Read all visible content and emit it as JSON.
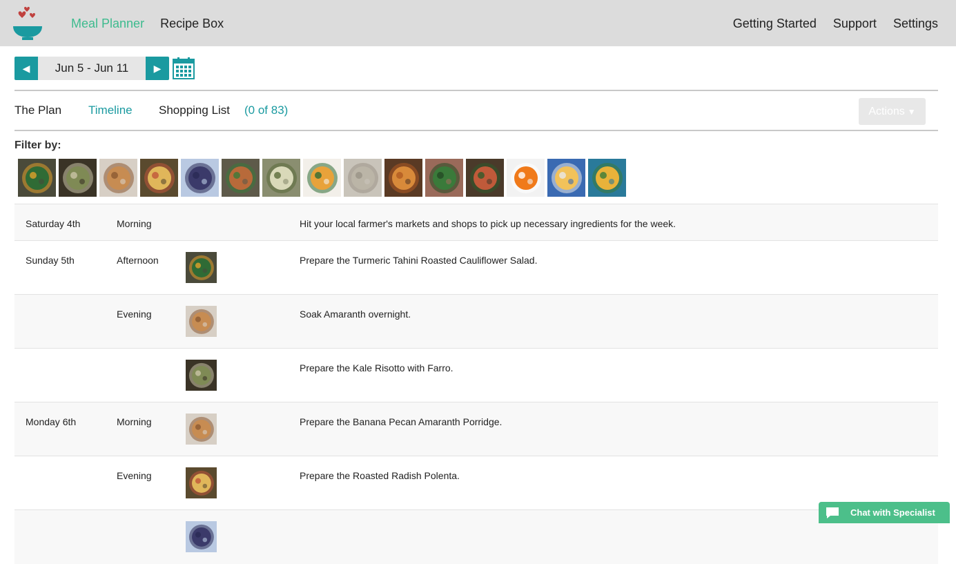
{
  "header": {
    "nav_left": [
      "Meal Planner",
      "Recipe Box"
    ],
    "nav_right": [
      "Getting Started",
      "Support",
      "Settings"
    ],
    "brand_color": "#3dbb8e"
  },
  "week": {
    "label": "Jun 5 - Jun 11",
    "accent": "#1a9aa0"
  },
  "tabs": {
    "plan": "The Plan",
    "timeline": "Timeline",
    "shopping": "Shopping List",
    "shopping_count": "(0 of 83)"
  },
  "actions_label": "Actions",
  "filter": {
    "label": "Filter by:",
    "thumbs": [
      {
        "bg": "#4a4a3a",
        "fg": "#2f6b35",
        "accent": "#e0a12a"
      },
      {
        "bg": "#3a3326",
        "fg": "#7f8a55",
        "accent": "#c9c3a5"
      },
      {
        "bg": "#d7cfc5",
        "fg": "#c78c52",
        "accent": "#8c5a32"
      },
      {
        "bg": "#5a4a2e",
        "fg": "#e0b65a",
        "accent": "#c0563a"
      },
      {
        "bg": "#b9c9e2",
        "fg": "#3b3a6a",
        "accent": "#2b2a55"
      },
      {
        "bg": "#5e5a4a",
        "fg": "#b86a3a",
        "accent": "#3b7a3a"
      },
      {
        "bg": "#8a8e70",
        "fg": "#d9d9b9",
        "accent": "#5a6a3a"
      },
      {
        "bg": "#f2efe9",
        "fg": "#e8a23a",
        "accent": "#2f6b35"
      },
      {
        "bg": "#c9c4ba",
        "fg": "#bbb5a7",
        "accent": "#9a9387"
      },
      {
        "bg": "#5a3a24",
        "fg": "#d88a3a",
        "accent": "#b05a22"
      },
      {
        "bg": "#9a6a5a",
        "fg": "#3a7a3a",
        "accent": "#244a24"
      },
      {
        "bg": "#4a3a2a",
        "fg": "#c05a3a",
        "accent": "#2f5a2a"
      },
      {
        "bg": "#f2f2f2",
        "fg": "#f07a1a",
        "accent": "#ffffff"
      },
      {
        "bg": "#3a6ab2",
        "fg": "#f2c25a",
        "accent": "#e8e8e8"
      },
      {
        "bg": "#2a7a9a",
        "fg": "#e8b23a",
        "accent": "#3a7a3a"
      }
    ]
  },
  "timeline": [
    {
      "day": "Saturday 4th",
      "time": "Morning",
      "thumb": null,
      "text": "Hit your local farmer's markets and shops to pick up necessary ingredients for the week."
    },
    {
      "day": "Sunday 5th",
      "time": "Afternoon",
      "thumb": 0,
      "text": "Prepare the Turmeric Tahini Roasted Cauliflower Salad."
    },
    {
      "day": "",
      "time": "Evening",
      "thumb": 2,
      "text": "Soak Amaranth overnight."
    },
    {
      "day": "",
      "time": "",
      "thumb": 1,
      "text": "Prepare the Kale Risotto with Farro."
    },
    {
      "day": "Monday 6th",
      "time": "Morning",
      "thumb": 2,
      "text": "Prepare the Banana Pecan Amaranth Porridge."
    },
    {
      "day": "",
      "time": "Evening",
      "thumb": 3,
      "text": "Prepare the Roasted Radish Polenta."
    },
    {
      "day": "",
      "time": "",
      "thumb": 4,
      "text": ""
    }
  ],
  "chat_label": "Chat with Specialist"
}
